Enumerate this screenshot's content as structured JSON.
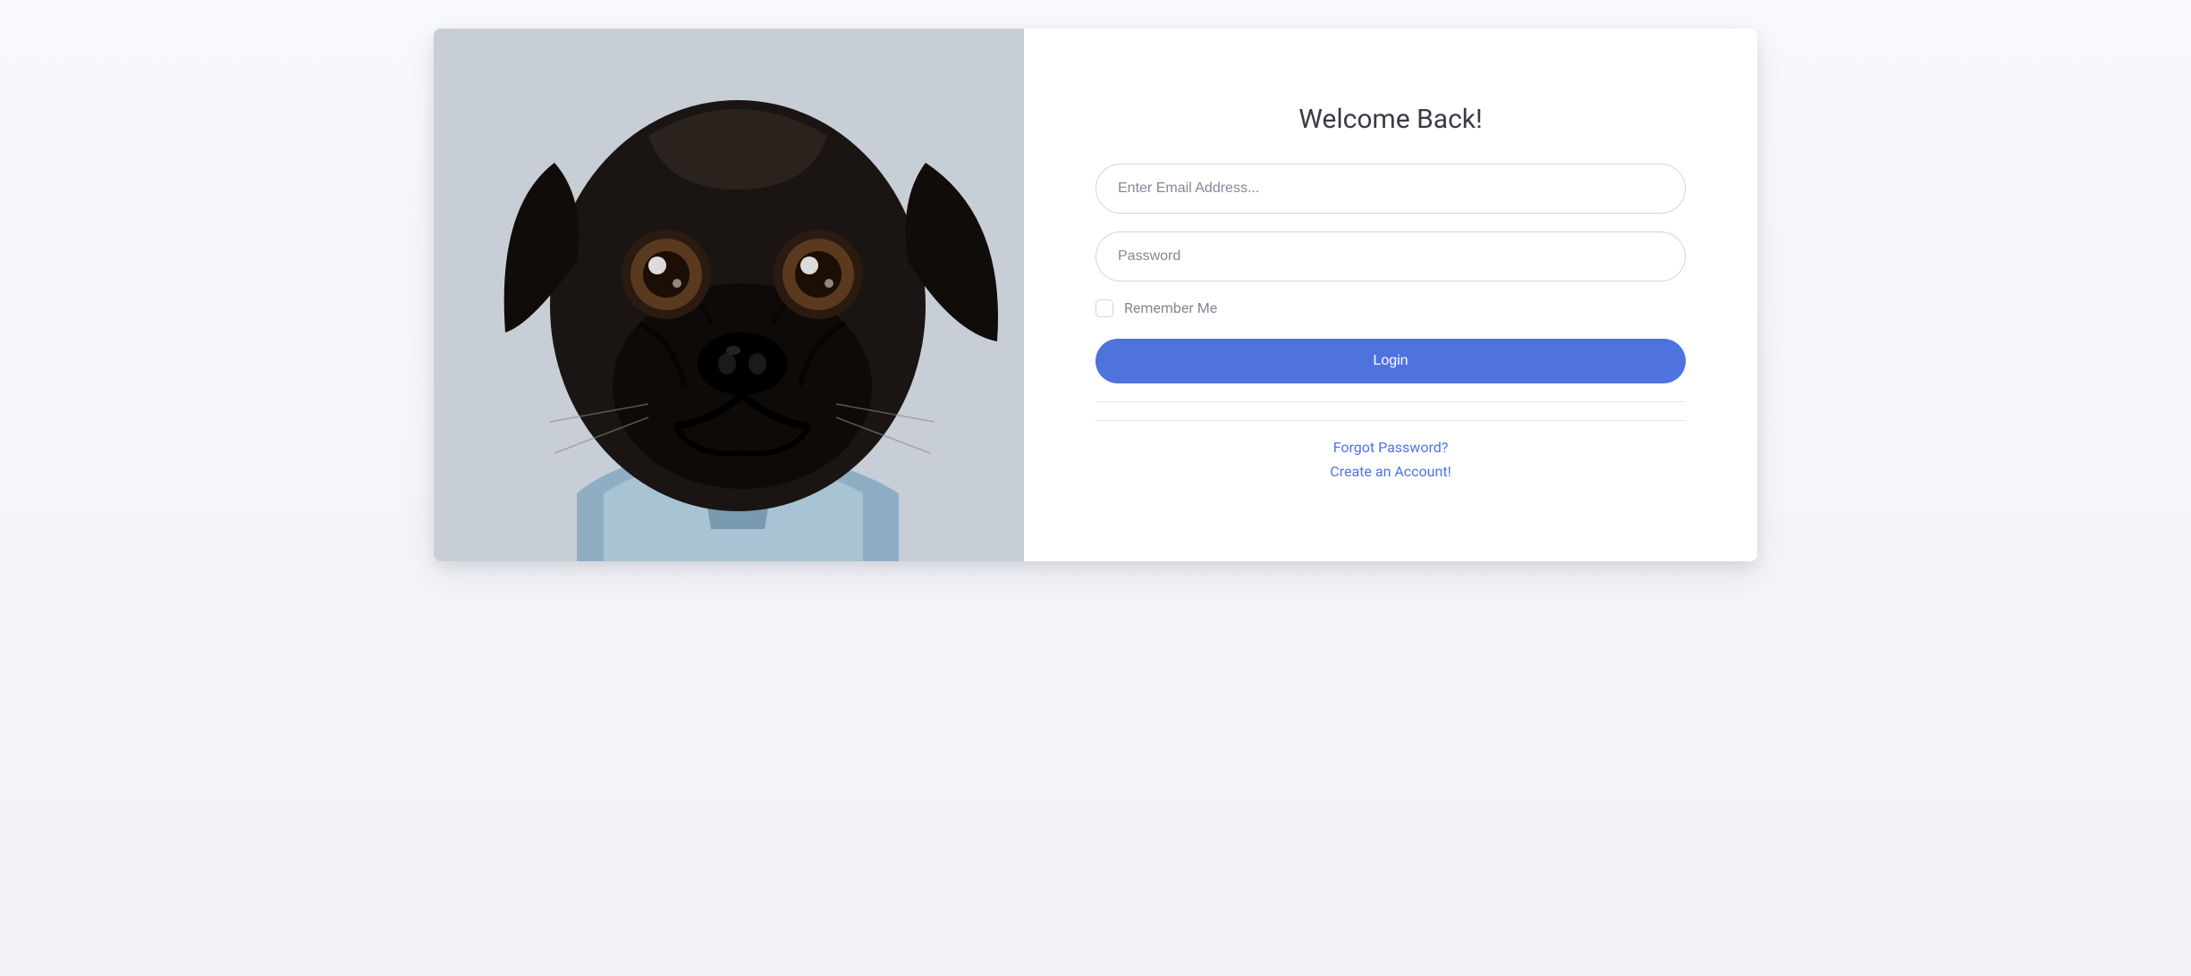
{
  "heading": "Welcome Back!",
  "form": {
    "email_placeholder": "Enter Email Address...",
    "password_placeholder": "Password",
    "remember_label": "Remember Me",
    "submit_label": "Login"
  },
  "links": {
    "forgot_password": "Forgot Password?",
    "create_account": "Create an Account!"
  },
  "image": {
    "alt": "black-pug-dog"
  }
}
